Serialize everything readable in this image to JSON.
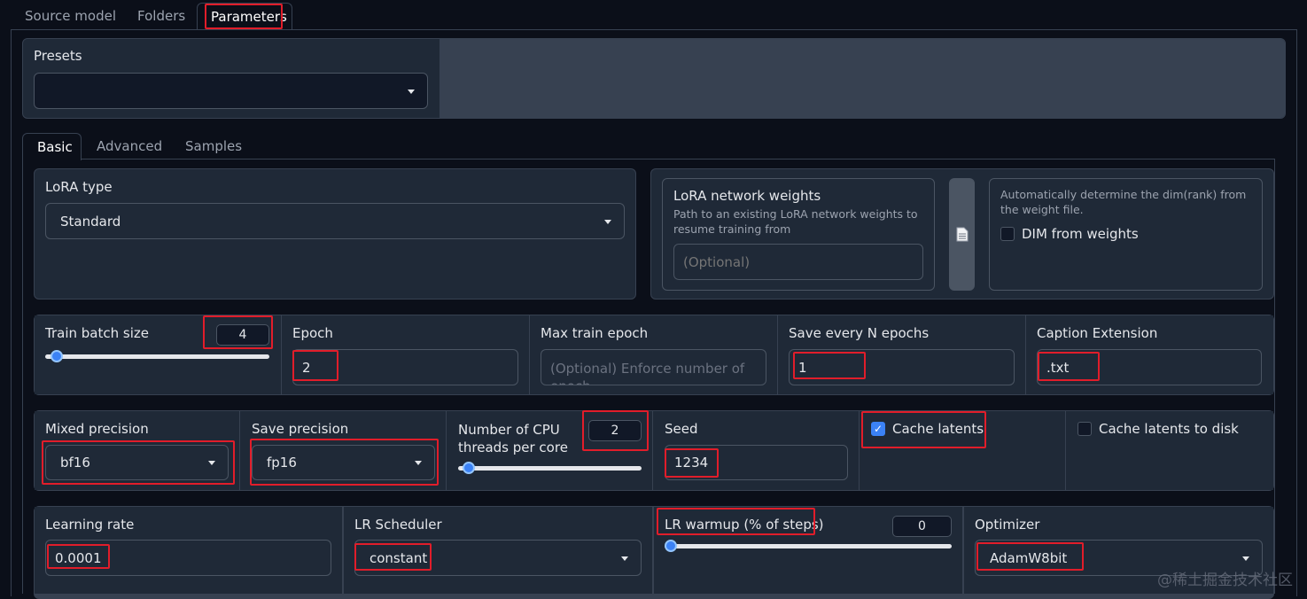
{
  "top_tabs": [
    "Source model",
    "Folders",
    "Parameters"
  ],
  "presets": {
    "label": "Presets",
    "value": ""
  },
  "sub_tabs": [
    "Basic",
    "Advanced",
    "Samples"
  ],
  "lora_type": {
    "label": "LoRA type",
    "value": "Standard"
  },
  "lora_network": {
    "label": "LoRA network weights",
    "description": "Path to an existing LoRA network weights to resume training from",
    "placeholder": "(Optional)",
    "file_icon": "document-icon"
  },
  "dim_from_weights": {
    "description": "Automatically determine the dim(rank) from the weight file.",
    "label": "DIM from weights",
    "checked": false
  },
  "train_batch_size": {
    "label": "Train batch size",
    "value": "4",
    "level": 0.04
  },
  "epoch": {
    "label": "Epoch",
    "value": "2"
  },
  "max_train_epoch": {
    "label": "Max train epoch",
    "placeholder": "(Optional) Enforce number of epoch"
  },
  "save_every_n_epochs": {
    "label": "Save every N epochs",
    "value": "1"
  },
  "caption_extension": {
    "label": "Caption Extension",
    "value": ".txt"
  },
  "mixed_precision": {
    "label": "Mixed precision",
    "value": "bf16"
  },
  "save_precision": {
    "label": "Save precision",
    "value": "fp16"
  },
  "cpu_threads": {
    "label_line1": "Number of CPU",
    "label_line2": "threads per core",
    "value": "2",
    "level": 0.04
  },
  "seed": {
    "label": "Seed",
    "value": "1234"
  },
  "cache_latents": {
    "label": "Cache latents",
    "checked": true
  },
  "cache_latents_to_disk": {
    "label": "Cache latents to disk",
    "checked": false
  },
  "learning_rate": {
    "label": "Learning rate",
    "value": "0.0001"
  },
  "lr_scheduler": {
    "label": "LR Scheduler",
    "value": "constant"
  },
  "lr_warmup": {
    "label": "LR warmup (% of steps)",
    "value": "0",
    "level": 0
  },
  "optimizer": {
    "label": "Optimizer",
    "value": "AdamW8bit"
  },
  "watermark": "@稀土掘金技术社区",
  "colors": {
    "accent": "#3b82f6",
    "highlight": "#e11d2a",
    "panel": "#1f2937",
    "background": "#0b0f19"
  }
}
